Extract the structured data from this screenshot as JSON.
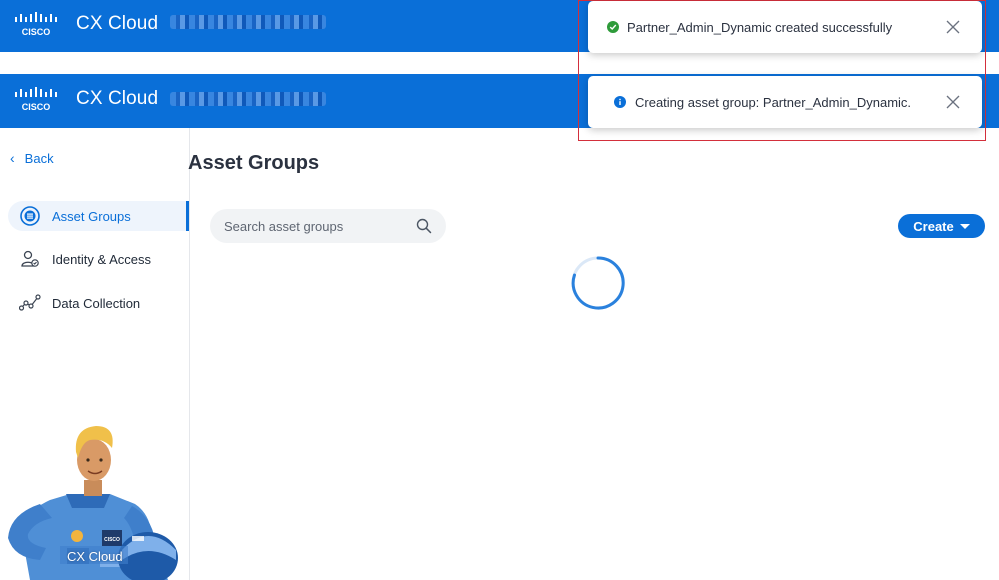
{
  "header": {
    "app_title": "CX Cloud",
    "brand_color": "#0a6fd8",
    "logo_icon": "cisco-logo"
  },
  "toasts": [
    {
      "status": "success",
      "icon": "check-circle-icon",
      "message": "Partner_Admin_Dynamic created successfully",
      "color": "#2e9b3a"
    },
    {
      "status": "info",
      "icon": "info-circle-icon",
      "message": "Creating asset group: Partner_Admin_Dynamic.",
      "color": "#0a6fd8"
    }
  ],
  "sidebar": {
    "back_label": "Back",
    "items": [
      {
        "label": "Asset Groups",
        "icon": "asset-groups-icon",
        "active": true
      },
      {
        "label": "Identity & Access",
        "icon": "identity-access-icon",
        "active": false
      },
      {
        "label": "Data Collection",
        "icon": "data-collection-icon",
        "active": false
      }
    ],
    "mascot_caption": "CX Cloud"
  },
  "main": {
    "page_title": "Asset Groups",
    "search_placeholder": "Search asset groups",
    "create_label": "Create",
    "loading": true
  },
  "highlight_color": "#d32f3b"
}
